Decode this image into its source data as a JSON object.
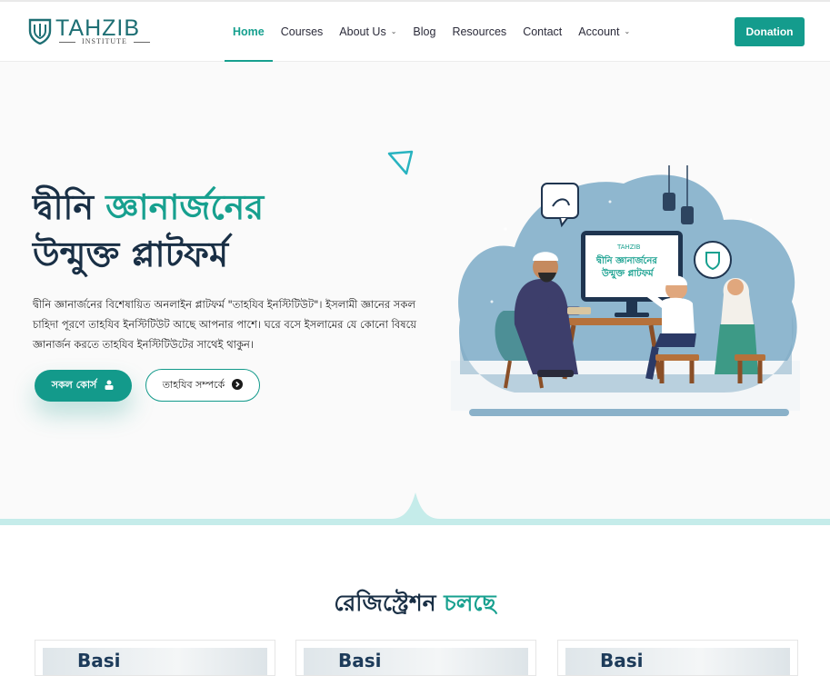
{
  "brand": {
    "name": "TAHZIB",
    "subtitle": "INSTITUTE"
  },
  "nav": [
    {
      "label": "Home",
      "active": true,
      "dropdown": false
    },
    {
      "label": "Courses",
      "active": false,
      "dropdown": false
    },
    {
      "label": "About Us",
      "active": false,
      "dropdown": true
    },
    {
      "label": "Blog",
      "active": false,
      "dropdown": false
    },
    {
      "label": "Resources",
      "active": false,
      "dropdown": false
    },
    {
      "label": "Contact",
      "active": false,
      "dropdown": false
    },
    {
      "label": "Account",
      "active": false,
      "dropdown": true
    }
  ],
  "donation_label": "Donation",
  "hero": {
    "title_line1_a": "দ্বীনি",
    "title_line1_b": "জ্ঞানার্জনের",
    "title_line2": "উন্মুক্ত প্লাটফর্ম",
    "description": "দ্বীনি জ্ঞানার্জনের বিশেষায়িত অনলাইন প্লাটফর্ম \"তাহযিব ইনস্টিটিউট\"। ইসলামী জ্ঞানের সকল চাহিদা পূরণে তাহযিব ইনস্টিটিউট আছে আপনার পাশে। ঘরে বসে ইসলামের যে কোনো বিষয়ে জ্ঞানার্জন করতে তাহযিব ইনস্টিটিউটের সাথেই থাকুন।",
    "primary_button": "সকল কোর্স",
    "secondary_button": "তাহযিব সম্পর্কে",
    "screen_brand": "TAHZIB",
    "screen_line1": "দ্বীনি জ্ঞানার্জনের",
    "screen_line2": "উন্মুক্ত প্লাটফর্ম"
  },
  "registration": {
    "title_a": "রেজিস্ট্রেশন",
    "title_b": "চলছে",
    "card_text": "Basi"
  },
  "colors": {
    "accent": "#17a08f",
    "dark": "#192f45",
    "button": "#139a8b"
  }
}
